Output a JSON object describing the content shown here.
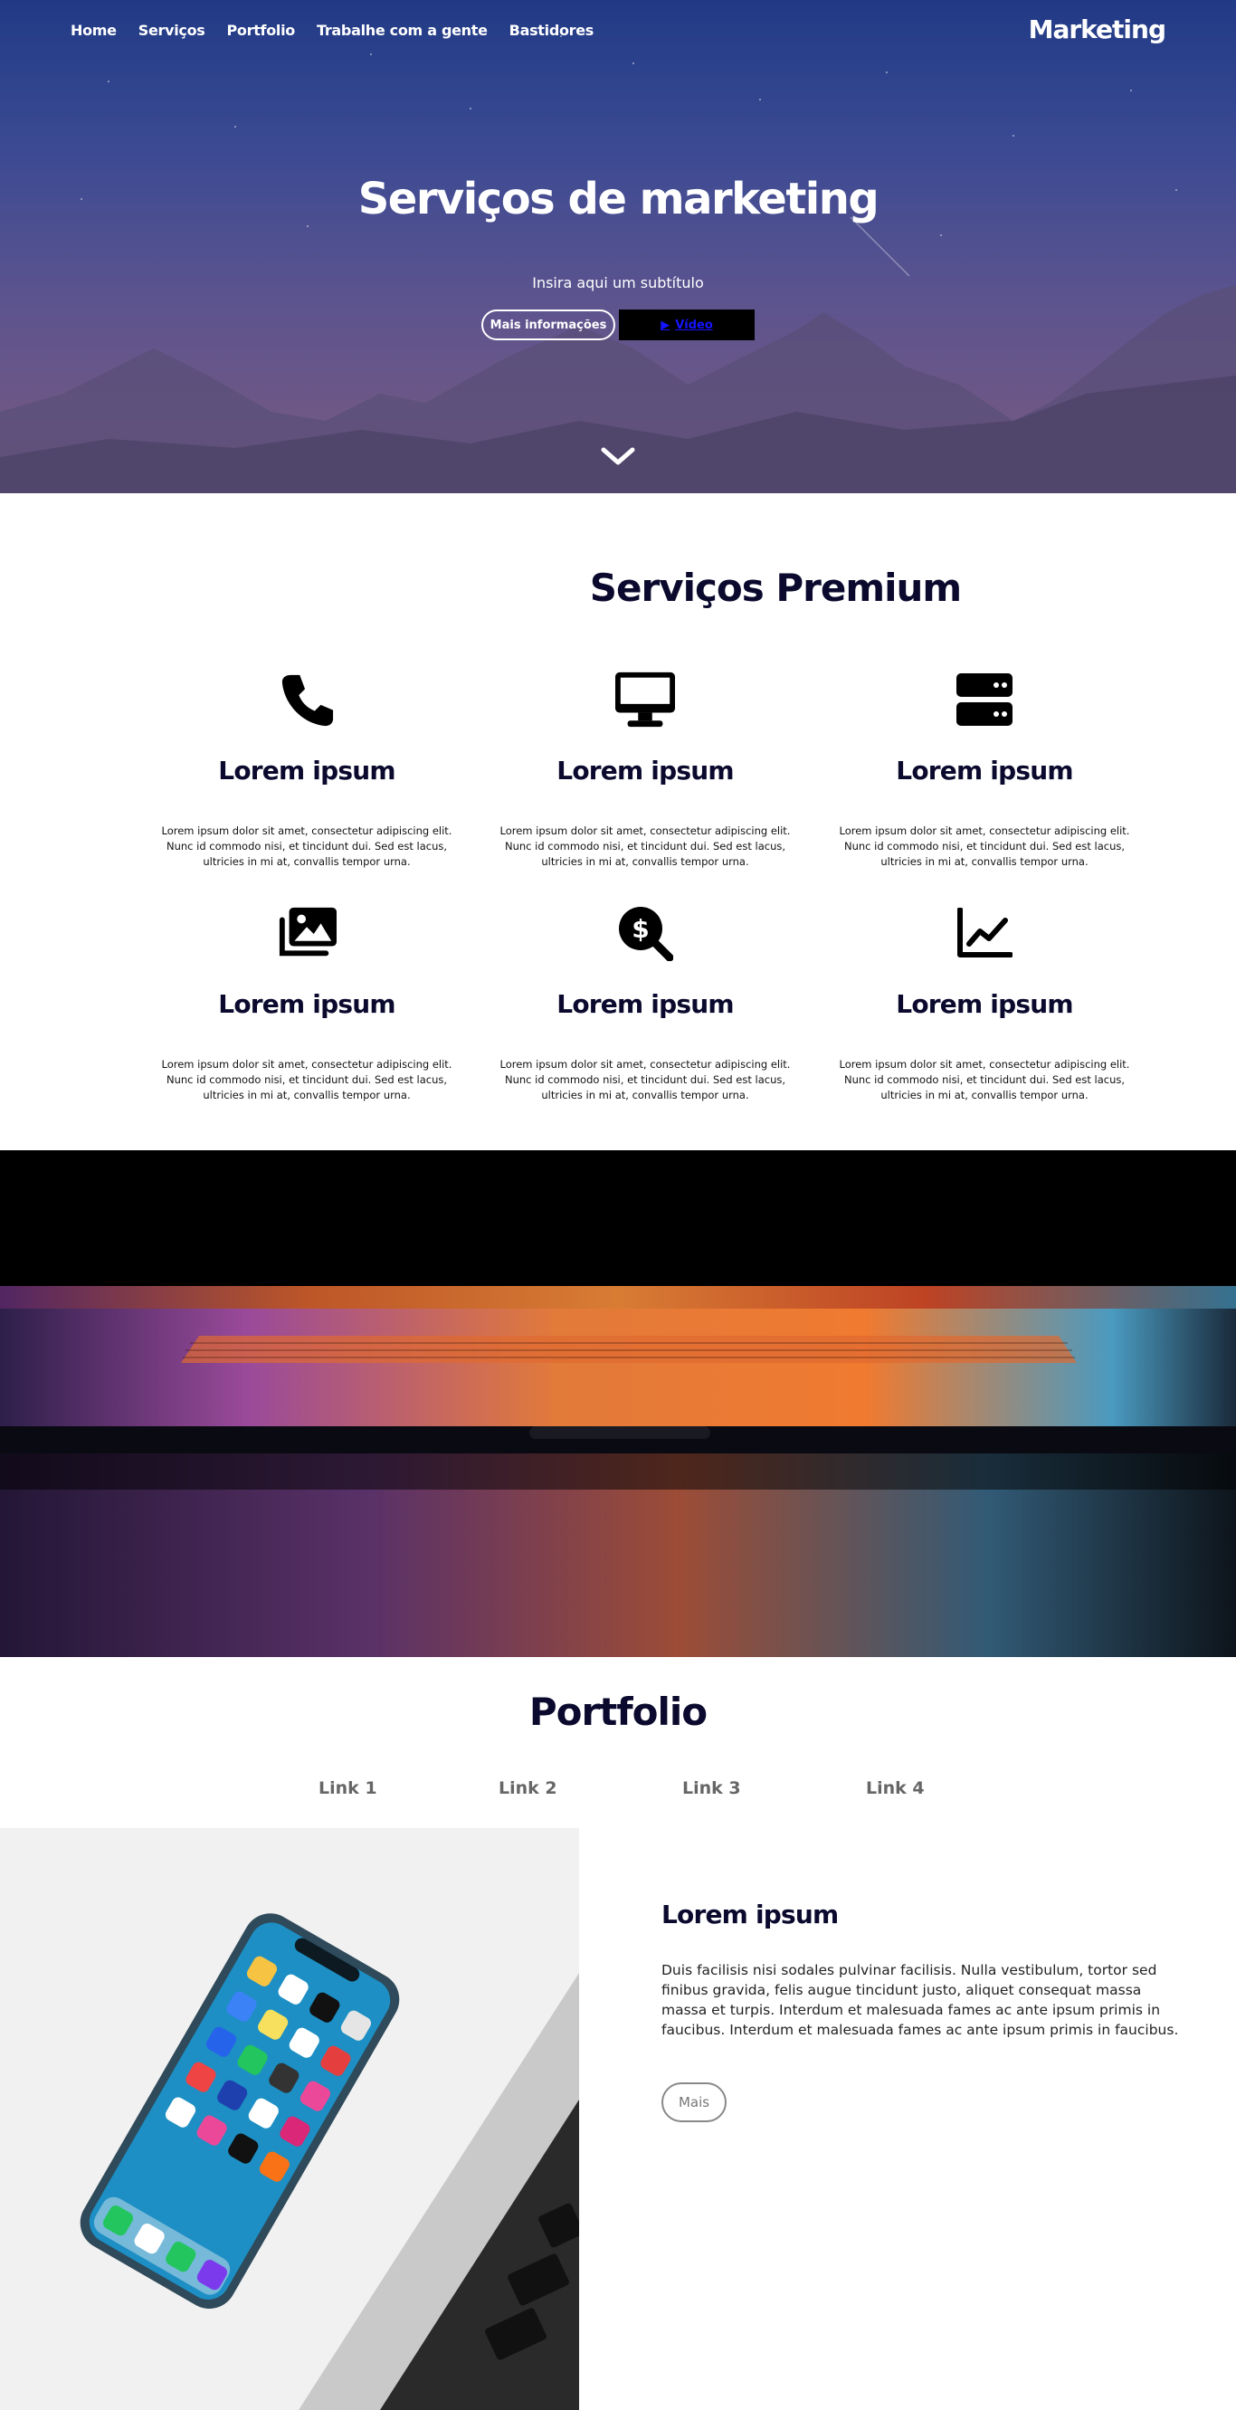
{
  "header": {
    "nav": [
      "Home",
      "Serviços",
      "Portfolio",
      "Trabalhe com a gente",
      "Bastidores"
    ],
    "brand": "Marketing",
    "title": "Serviços de marketing",
    "subtitle": "Insira aqui um subtítulo",
    "btn_more": "Mais informações",
    "btn_video": "Vídeo"
  },
  "services": {
    "title": "Serviços Premium",
    "items": [
      {
        "icon": "phone-icon",
        "title": "Lorem ipsum",
        "text": "Lorem ipsum dolor sit amet, consectetur adipiscing elit. Nunc id commodo nisi, et tincidunt dui. Sed est lacus, ultricies in mi at, convallis tempor urna."
      },
      {
        "icon": "desktop-icon",
        "title": "Lorem ipsum",
        "text": "Lorem ipsum dolor sit amet, consectetur adipiscing elit. Nunc id commodo nisi, et tincidunt dui. Sed est lacus, ultricies in mi at, convallis tempor urna."
      },
      {
        "icon": "server-icon",
        "title": "Lorem ipsum",
        "text": "Lorem ipsum dolor sit amet, consectetur adipiscing elit. Nunc id commodo nisi, et tincidunt dui. Sed est lacus, ultricies in mi at, convallis tempor urna."
      },
      {
        "icon": "images-icon",
        "title": "Lorem ipsum",
        "text": "Lorem ipsum dolor sit amet, consectetur adipiscing elit. Nunc id commodo nisi, et tincidunt dui. Sed est lacus, ultricies in mi at, convallis tempor urna."
      },
      {
        "icon": "search-dollar-icon",
        "title": "Lorem ipsum",
        "text": "Lorem ipsum dolor sit amet, consectetur adipiscing elit. Nunc id commodo nisi, et tincidunt dui. Sed est lacus, ultricies in mi at, convallis tempor urna."
      },
      {
        "icon": "chart-line-icon",
        "title": "Lorem ipsum",
        "text": "Lorem ipsum dolor sit amet, consectetur adipiscing elit. Nunc id commodo nisi, et tincidunt dui. Sed est lacus, ultricies in mi at, convallis tempor urna."
      }
    ]
  },
  "portfolio": {
    "title": "Portfolio",
    "tabs": [
      "Link 1",
      "Link 2",
      "Link 3",
      "Link 4"
    ],
    "item_title": "Lorem ipsum",
    "item_text": "Duis facilisis nisi sodales pulvinar facilisis. Nulla vestibulum, tortor sed finibus gravida, felis augue tincidunt justo, aliquet consequat massa massa et turpis. Interdum et malesuada fames ac ante ipsum primis in faucibus. Interdum et malesuada fames ac ante ipsum primis in faucibus.",
    "item_button": "Mais"
  },
  "colors": {
    "heading": "#0b0a2e",
    "hero_top": "#213a86",
    "hero_bottom": "#7a5a80",
    "video_link": "#1414ff"
  }
}
